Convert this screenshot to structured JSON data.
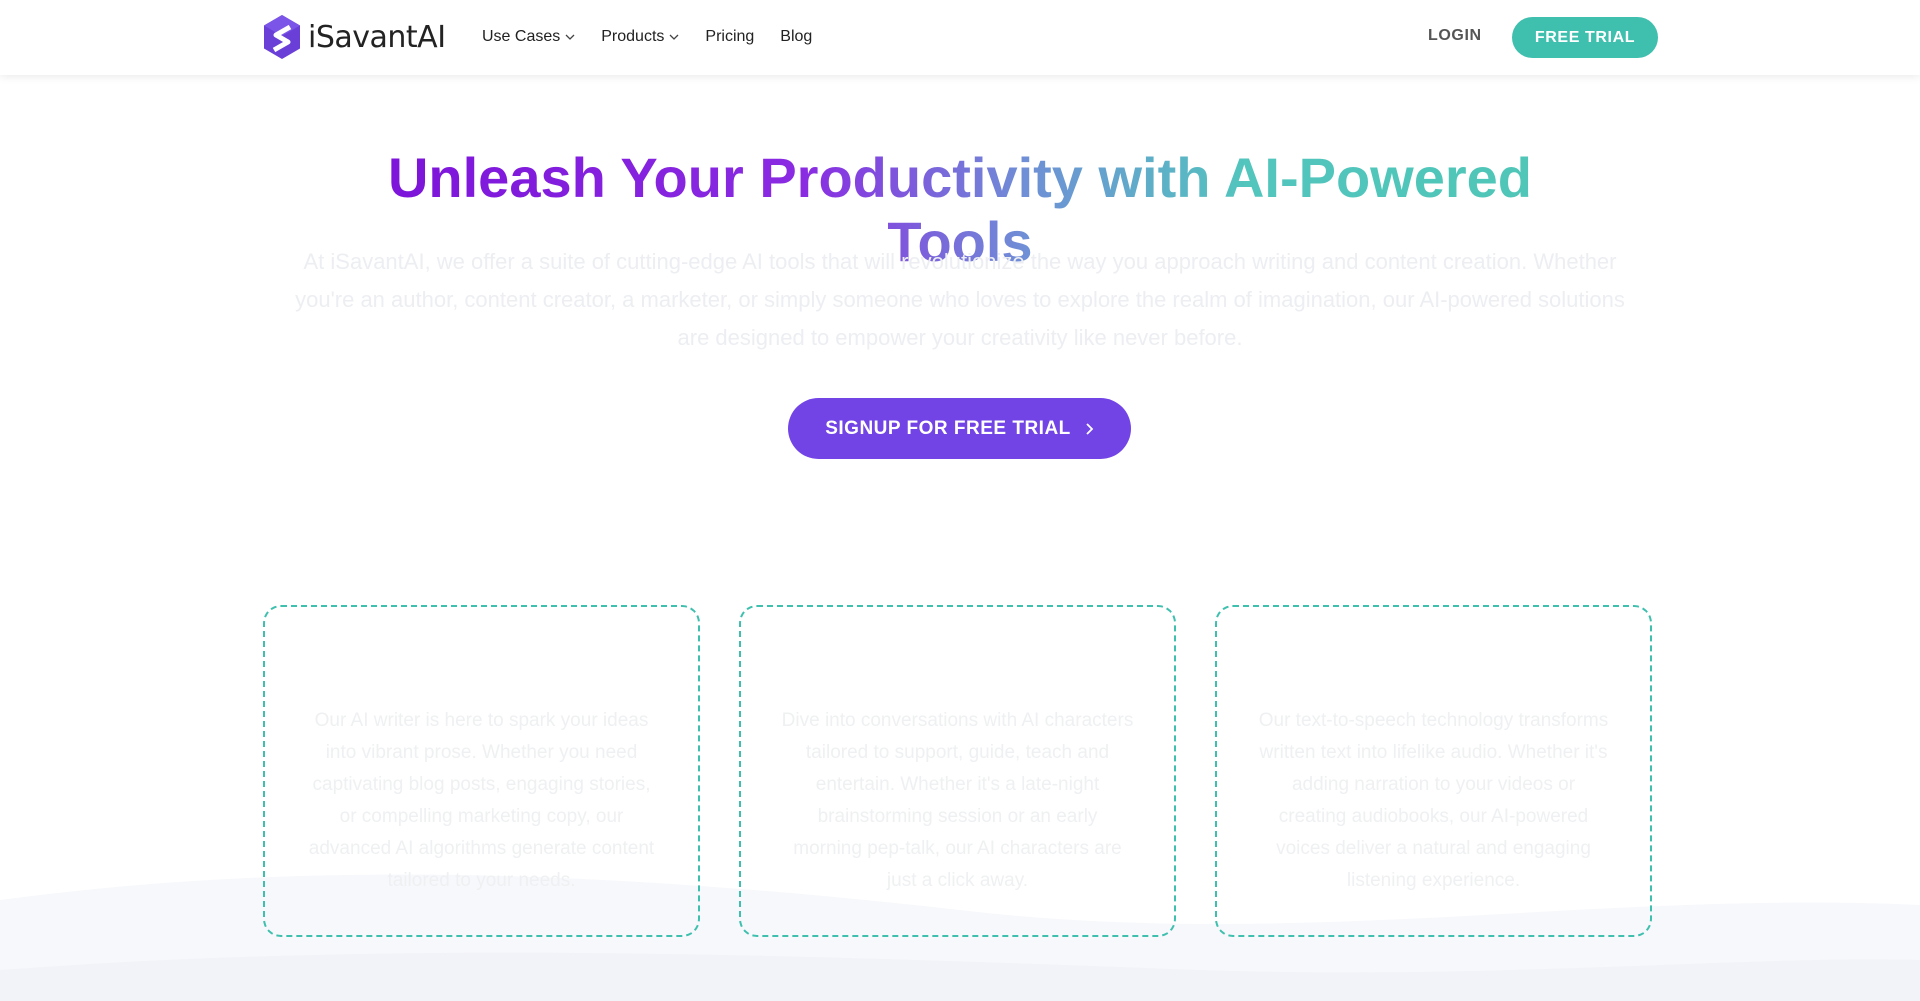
{
  "header": {
    "logo_text": "iSavantAI",
    "nav": [
      {
        "label": "Use Cases",
        "has_dropdown": true
      },
      {
        "label": "Products",
        "has_dropdown": true
      },
      {
        "label": "Pricing",
        "has_dropdown": false
      },
      {
        "label": "Blog",
        "has_dropdown": false
      }
    ],
    "login_label": "LOGIN",
    "free_trial_label": "FREE TRIAL"
  },
  "hero": {
    "title": "Unleash Your Productivity with AI-Powered Tools",
    "description": "At iSavantAI, we offer a suite of cutting-edge AI tools that will revolutionize the way you approach writing and content creation. Whether you're an author, content creator, a marketer, or simply someone who loves to explore the realm of imagination, our AI-powered solutions are designed to empower your creativity like never before.",
    "cta_label": "SIGNUP FOR FREE TRIAL"
  },
  "cards": [
    {
      "text": "Our AI writer is here to spark your ideas into vibrant prose. Whether you need captivating blog posts, engaging stories, or compelling marketing copy, our advanced AI algorithms generate content tailored to your needs."
    },
    {
      "text": "Dive into conversations with AI characters tailored to support, guide, teach and entertain. Whether it's a late-night brainstorming session or an early morning pep-talk, our AI characters are just a click away."
    },
    {
      "text": "Our text-to-speech technology transforms written text into lifelike audio. Whether it's adding narration to your videos or creating audiobooks, our AI-powered voices deliver a natural and engaging listening experience."
    }
  ],
  "colors": {
    "brand_purple": "#7244e6",
    "brand_teal": "#3fbfae",
    "title_gradient_start": "#7b10d8",
    "title_gradient_end": "#4ec6b6"
  },
  "icons": {
    "logo": "hexagon-s-logo-icon",
    "dropdown": "chevron-down-icon",
    "cta_arrow": "chevron-right-icon"
  }
}
